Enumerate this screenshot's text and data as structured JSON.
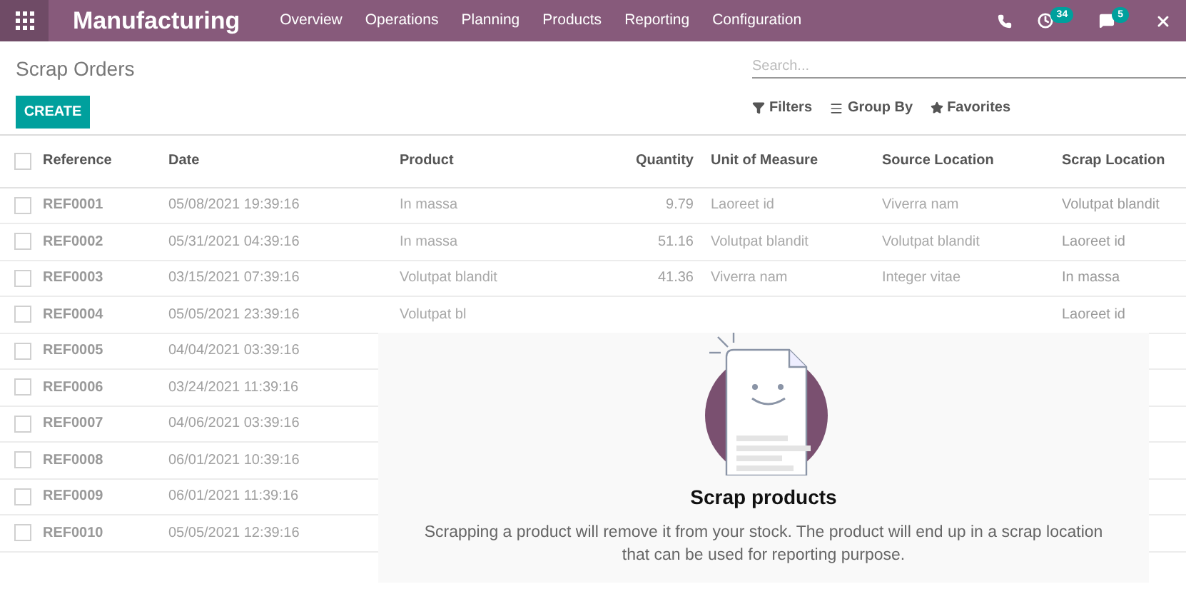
{
  "navbar": {
    "app_title": "Manufacturing",
    "menu": [
      {
        "label": "Overview"
      },
      {
        "label": "Operations"
      },
      {
        "label": "Planning"
      },
      {
        "label": "Products"
      },
      {
        "label": "Reporting"
      },
      {
        "label": "Configuration"
      }
    ],
    "activity_count": "34",
    "message_count": "5"
  },
  "control_panel": {
    "breadcrumb": "Scrap Orders",
    "create_button": "CREATE",
    "search": {
      "placeholder": "Search..."
    },
    "filters": "Filters",
    "group_by": "Group By",
    "favorites": "Favorites"
  },
  "table": {
    "select_all_checked": false,
    "columns": [
      "Reference",
      "Date",
      "Product",
      "Quantity",
      "Unit of Measure",
      "Source Location",
      "Scrap Location"
    ],
    "rows": [
      {
        "checked": false,
        "cells": [
          "REF0001",
          "05/08/2021 19:39:16",
          "In massa",
          "9.79",
          "Laoreet id",
          "Viverra nam",
          "Volutpat blandit"
        ]
      },
      {
        "checked": false,
        "cells": [
          "REF0002",
          "05/31/2021 04:39:16",
          "In massa",
          "51.16",
          "Volutpat blandit",
          "Volutpat blandit",
          "Laoreet id"
        ]
      },
      {
        "checked": false,
        "cells": [
          "REF0003",
          "03/15/2021 07:39:16",
          "Volutpat blandit",
          "41.36",
          "Viverra nam",
          "Integer vitae",
          "In massa"
        ]
      },
      {
        "checked": false,
        "cells": [
          "REF0004",
          "05/05/2021 23:39:16",
          "Volutpat bl",
          "",
          "",
          "",
          "Laoreet id"
        ]
      },
      {
        "checked": false,
        "cells": [
          "REF0005",
          "04/04/2021 03:39:16",
          "",
          "",
          "",
          "",
          ""
        ]
      },
      {
        "checked": false,
        "cells": [
          "REF0006",
          "03/24/2021 11:39:16",
          "",
          "",
          "",
          "",
          ""
        ]
      },
      {
        "checked": false,
        "cells": [
          "REF0007",
          "04/06/2021 03:39:16",
          "",
          "",
          "",
          "",
          ""
        ]
      },
      {
        "checked": false,
        "cells": [
          "REF0008",
          "06/01/2021 10:39:16",
          "",
          "",
          "",
          "",
          ""
        ]
      },
      {
        "checked": false,
        "cells": [
          "REF0009",
          "06/01/2021 11:39:16",
          "",
          "",
          "",
          "",
          ""
        ]
      },
      {
        "checked": false,
        "cells": [
          "REF0010",
          "05/05/2021 12:39:16",
          "",
          "",
          "",
          "",
          ""
        ]
      }
    ]
  },
  "empty_state": {
    "title": "Scrap products",
    "description": "Scrapping a product will remove it from your stock. The product will end up in a scrap location that can be used for reporting purpose."
  }
}
